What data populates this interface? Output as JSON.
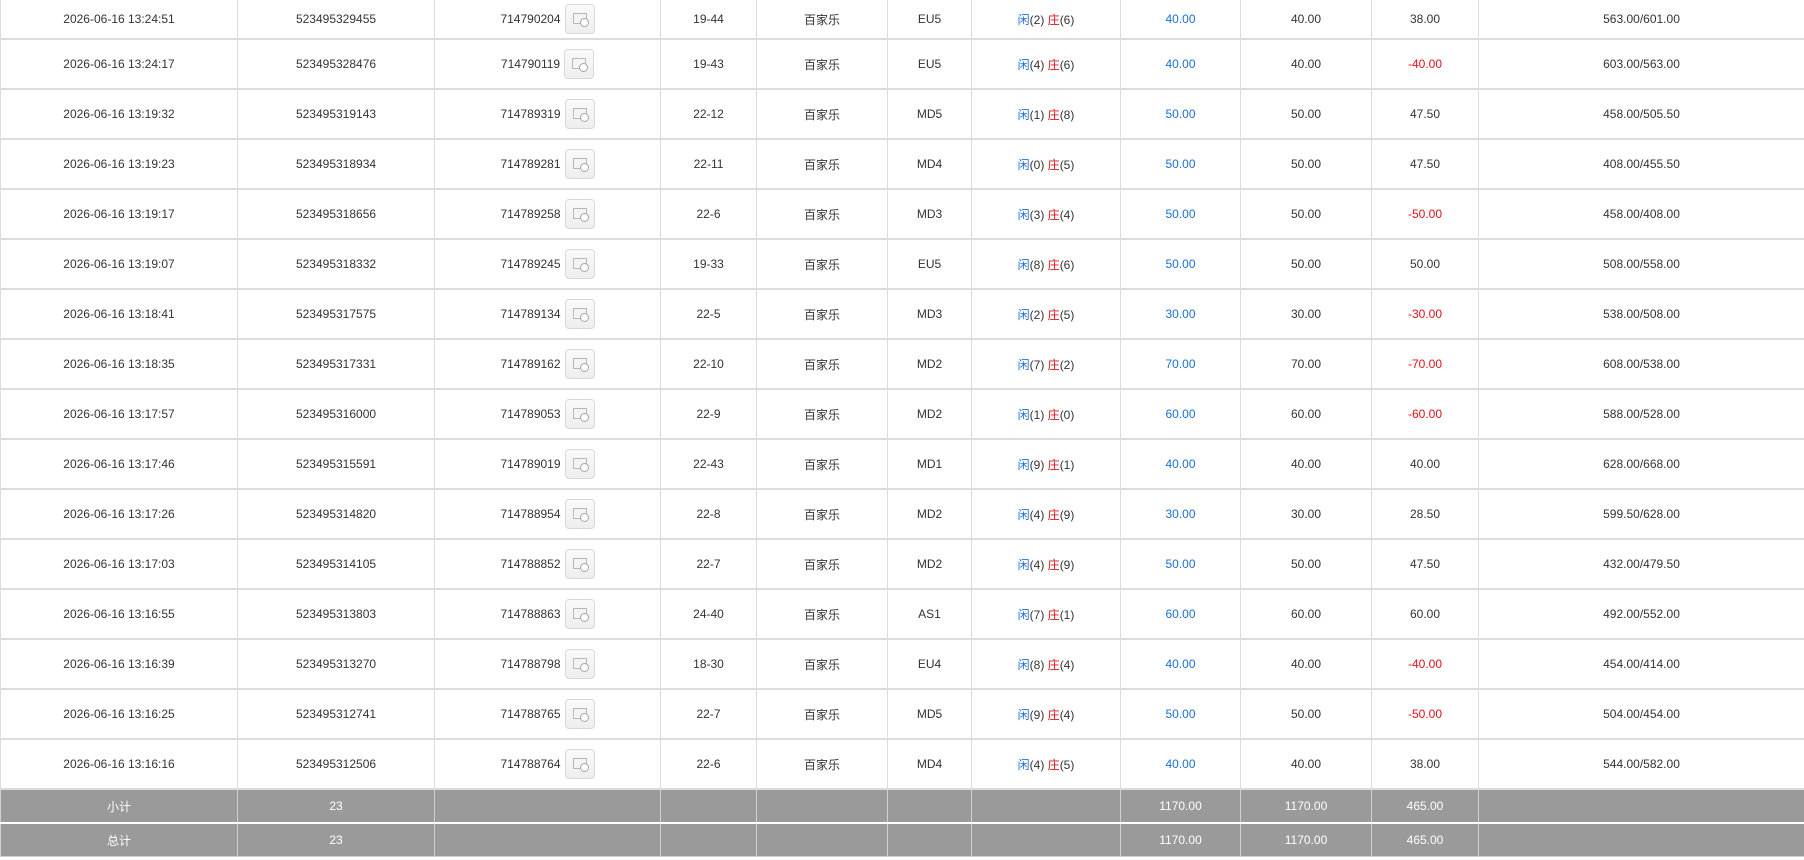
{
  "rows": [
    {
      "time": "2026-06-16 13:24:51",
      "bet_id": "523495329455",
      "ticket": "714790204",
      "round": "19-44",
      "game": "百家乐",
      "table": "EU5",
      "player_label": "闲",
      "player_val": "(2)",
      "banker_label": "庄",
      "banker_val": "(6)",
      "bet": "40.00",
      "valid": "40.00",
      "win": "38.00",
      "balance": "563.00/601.00"
    },
    {
      "time": "2026-06-16 13:24:17",
      "bet_id": "523495328476",
      "ticket": "714790119",
      "round": "19-43",
      "game": "百家乐",
      "table": "EU5",
      "player_label": "闲",
      "player_val": "(4)",
      "banker_label": "庄",
      "banker_val": "(6)",
      "bet": "40.00",
      "valid": "40.00",
      "win": "-40.00",
      "balance": "603.00/563.00"
    },
    {
      "time": "2026-06-16 13:19:32",
      "bet_id": "523495319143",
      "ticket": "714789319",
      "round": "22-12",
      "game": "百家乐",
      "table": "MD5",
      "player_label": "闲",
      "player_val": "(1)",
      "banker_label": "庄",
      "banker_val": "(8)",
      "bet": "50.00",
      "valid": "50.00",
      "win": "47.50",
      "balance": "458.00/505.50"
    },
    {
      "time": "2026-06-16 13:19:23",
      "bet_id": "523495318934",
      "ticket": "714789281",
      "round": "22-11",
      "game": "百家乐",
      "table": "MD4",
      "player_label": "闲",
      "player_val": "(0)",
      "banker_label": "庄",
      "banker_val": "(5)",
      "bet": "50.00",
      "valid": "50.00",
      "win": "47.50",
      "balance": "408.00/455.50"
    },
    {
      "time": "2026-06-16 13:19:17",
      "bet_id": "523495318656",
      "ticket": "714789258",
      "round": "22-6",
      "game": "百家乐",
      "table": "MD3",
      "player_label": "闲",
      "player_val": "(3)",
      "banker_label": "庄",
      "banker_val": "(4)",
      "bet": "50.00",
      "valid": "50.00",
      "win": "-50.00",
      "balance": "458.00/408.00"
    },
    {
      "time": "2026-06-16 13:19:07",
      "bet_id": "523495318332",
      "ticket": "714789245",
      "round": "19-33",
      "game": "百家乐",
      "table": "EU5",
      "player_label": "闲",
      "player_val": "(8)",
      "banker_label": "庄",
      "banker_val": "(6)",
      "bet": "50.00",
      "valid": "50.00",
      "win": "50.00",
      "balance": "508.00/558.00"
    },
    {
      "time": "2026-06-16 13:18:41",
      "bet_id": "523495317575",
      "ticket": "714789134",
      "round": "22-5",
      "game": "百家乐",
      "table": "MD3",
      "player_label": "闲",
      "player_val": "(2)",
      "banker_label": "庄",
      "banker_val": "(5)",
      "bet": "30.00",
      "valid": "30.00",
      "win": "-30.00",
      "balance": "538.00/508.00"
    },
    {
      "time": "2026-06-16 13:18:35",
      "bet_id": "523495317331",
      "ticket": "714789162",
      "round": "22-10",
      "game": "百家乐",
      "table": "MD2",
      "player_label": "闲",
      "player_val": "(7)",
      "banker_label": "庄",
      "banker_val": "(2)",
      "bet": "70.00",
      "valid": "70.00",
      "win": "-70.00",
      "balance": "608.00/538.00"
    },
    {
      "time": "2026-06-16 13:17:57",
      "bet_id": "523495316000",
      "ticket": "714789053",
      "round": "22-9",
      "game": "百家乐",
      "table": "MD2",
      "player_label": "闲",
      "player_val": "(1)",
      "banker_label": "庄",
      "banker_val": "(0)",
      "bet": "60.00",
      "valid": "60.00",
      "win": "-60.00",
      "balance": "588.00/528.00"
    },
    {
      "time": "2026-06-16 13:17:46",
      "bet_id": "523495315591",
      "ticket": "714789019",
      "round": "22-43",
      "game": "百家乐",
      "table": "MD1",
      "player_label": "闲",
      "player_val": "(9)",
      "banker_label": "庄",
      "banker_val": "(1)",
      "bet": "40.00",
      "valid": "40.00",
      "win": "40.00",
      "balance": "628.00/668.00"
    },
    {
      "time": "2026-06-16 13:17:26",
      "bet_id": "523495314820",
      "ticket": "714788954",
      "round": "22-8",
      "game": "百家乐",
      "table": "MD2",
      "player_label": "闲",
      "player_val": "(4)",
      "banker_label": "庄",
      "banker_val": "(9)",
      "bet": "30.00",
      "valid": "30.00",
      "win": "28.50",
      "balance": "599.50/628.00"
    },
    {
      "time": "2026-06-16 13:17:03",
      "bet_id": "523495314105",
      "ticket": "714788852",
      "round": "22-7",
      "game": "百家乐",
      "table": "MD2",
      "player_label": "闲",
      "player_val": "(4)",
      "banker_label": "庄",
      "banker_val": "(9)",
      "bet": "50.00",
      "valid": "50.00",
      "win": "47.50",
      "balance": "432.00/479.50"
    },
    {
      "time": "2026-06-16 13:16:55",
      "bet_id": "523495313803",
      "ticket": "714788863",
      "round": "24-40",
      "game": "百家乐",
      "table": "AS1",
      "player_label": "闲",
      "player_val": "(7)",
      "banker_label": "庄",
      "banker_val": "(1)",
      "bet": "60.00",
      "valid": "60.00",
      "win": "60.00",
      "balance": "492.00/552.00"
    },
    {
      "time": "2026-06-16 13:16:39",
      "bet_id": "523495313270",
      "ticket": "714788798",
      "round": "18-30",
      "game": "百家乐",
      "table": "EU4",
      "player_label": "闲",
      "player_val": "(8)",
      "banker_label": "庄",
      "banker_val": "(4)",
      "bet": "40.00",
      "valid": "40.00",
      "win": "-40.00",
      "balance": "454.00/414.00"
    },
    {
      "time": "2026-06-16 13:16:25",
      "bet_id": "523495312741",
      "ticket": "714788765",
      "round": "22-7",
      "game": "百家乐",
      "table": "MD5",
      "player_label": "闲",
      "player_val": "(9)",
      "banker_label": "庄",
      "banker_val": "(4)",
      "bet": "50.00",
      "valid": "50.00",
      "win": "-50.00",
      "balance": "504.00/454.00"
    },
    {
      "time": "2026-06-16 13:16:16",
      "bet_id": "523495312506",
      "ticket": "714788764",
      "round": "22-6",
      "game": "百家乐",
      "table": "MD4",
      "player_label": "闲",
      "player_val": "(4)",
      "banker_label": "庄",
      "banker_val": "(5)",
      "bet": "40.00",
      "valid": "40.00",
      "win": "38.00",
      "balance": "544.00/582.00"
    }
  ],
  "subtotal": {
    "label": "小计",
    "count": "23",
    "bet": "1170.00",
    "valid": "1170.00",
    "win": "465.00"
  },
  "total": {
    "label": "总计",
    "count": "23",
    "bet": "1170.00",
    "valid": "1170.00",
    "win": "465.00"
  },
  "colors": {
    "player": "#1a6fd6",
    "banker": "#e0101a",
    "loss": "#e0101a",
    "summary_bg": "#9a9a9a"
  },
  "icons": {
    "detail": "detail-view-icon"
  }
}
